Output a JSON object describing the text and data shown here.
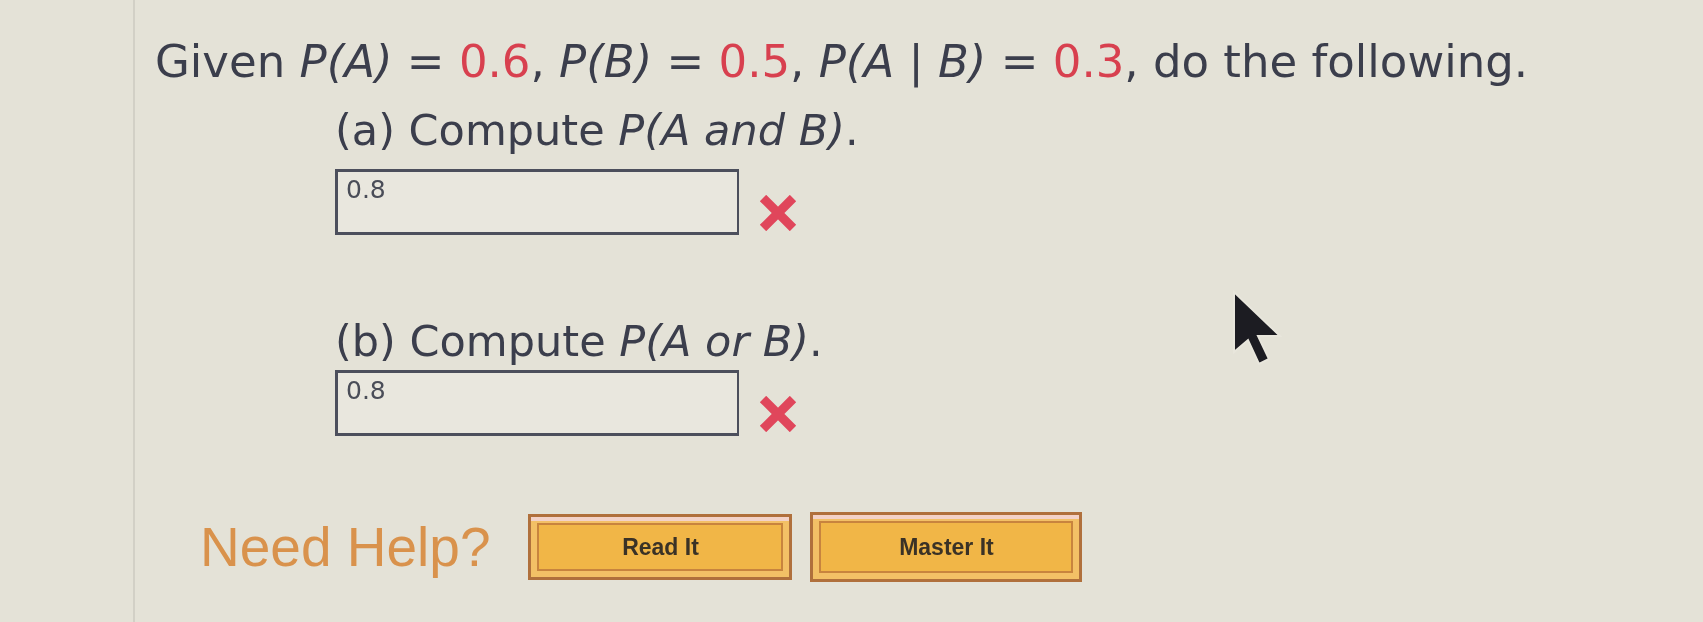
{
  "question": {
    "segments": [
      {
        "kind": "text",
        "text": "Given *P(A)* = "
      },
      {
        "kind": "given",
        "text": "0.6"
      },
      {
        "kind": "text",
        "text": ", *P(B)* = "
      },
      {
        "kind": "given",
        "text": "0.5"
      },
      {
        "kind": "text",
        "text": ", *P(A* | *B)* = "
      },
      {
        "kind": "given",
        "text": "0.3"
      },
      {
        "kind": "text",
        "text": ", do the following."
      }
    ]
  },
  "parts": [
    {
      "label": "(a) Compute *P(A and B)*.",
      "answer": "0.8",
      "correct": false
    },
    {
      "label": "(b) Compute *P(A or B)*.",
      "answer": "0.8",
      "correct": false
    }
  ],
  "help": {
    "label": "Need Help?",
    "buttons": [
      "Read It",
      "Master It"
    ]
  }
}
